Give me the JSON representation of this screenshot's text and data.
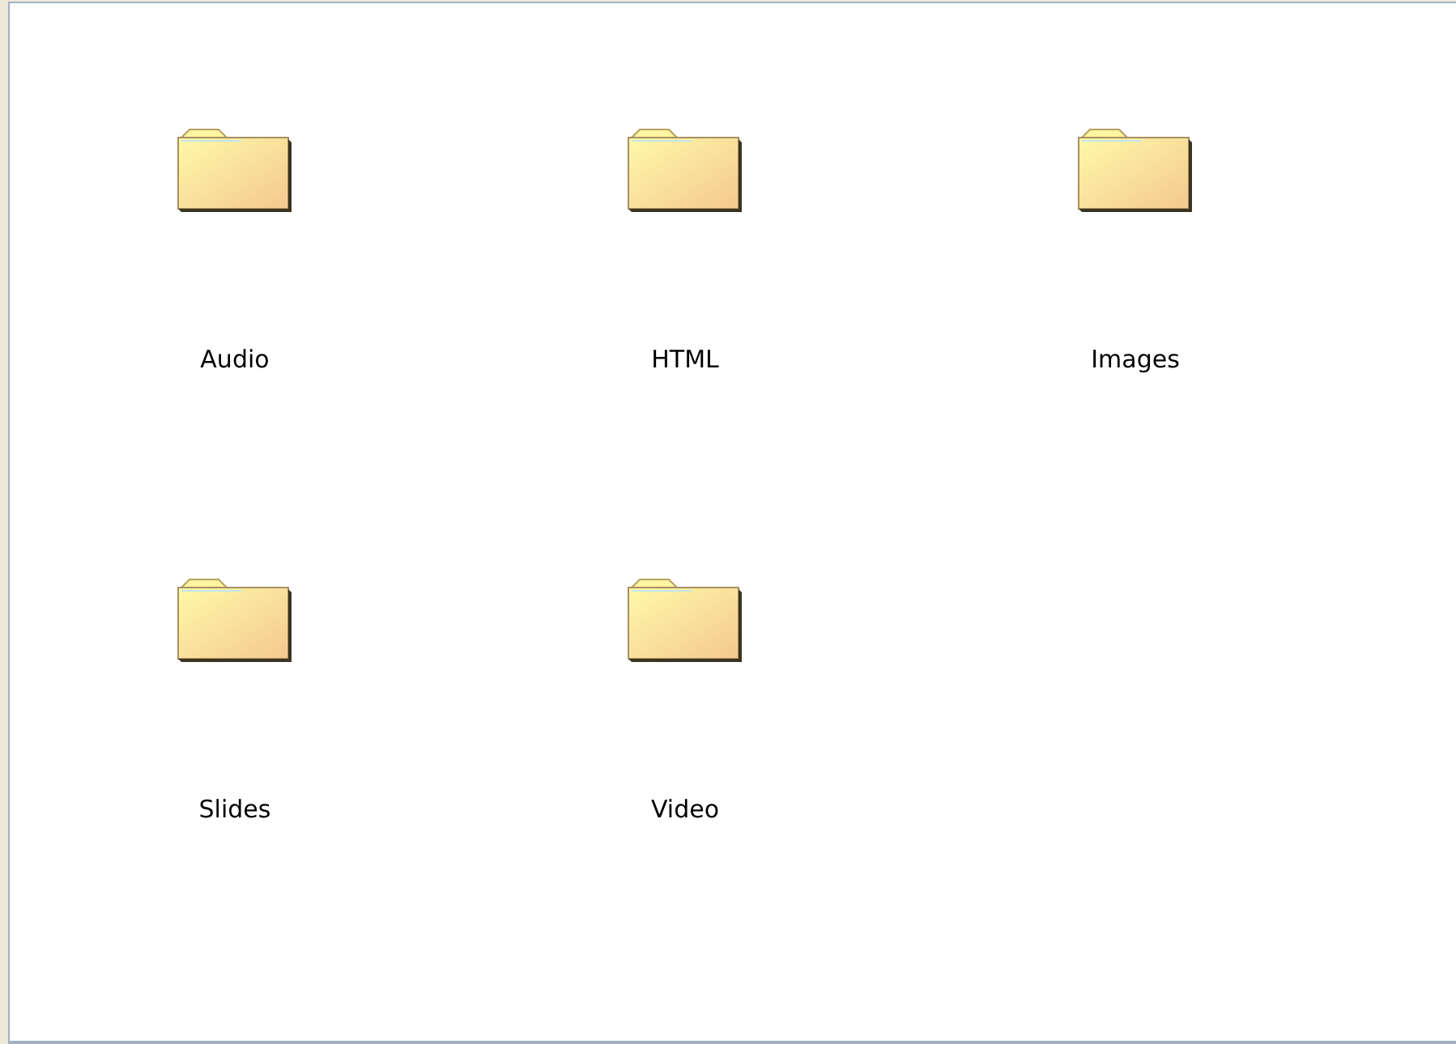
{
  "folders": [
    {
      "name": "Audio"
    },
    {
      "name": "HTML"
    },
    {
      "name": "Images"
    },
    {
      "name": "Slides"
    },
    {
      "name": "Video"
    }
  ]
}
